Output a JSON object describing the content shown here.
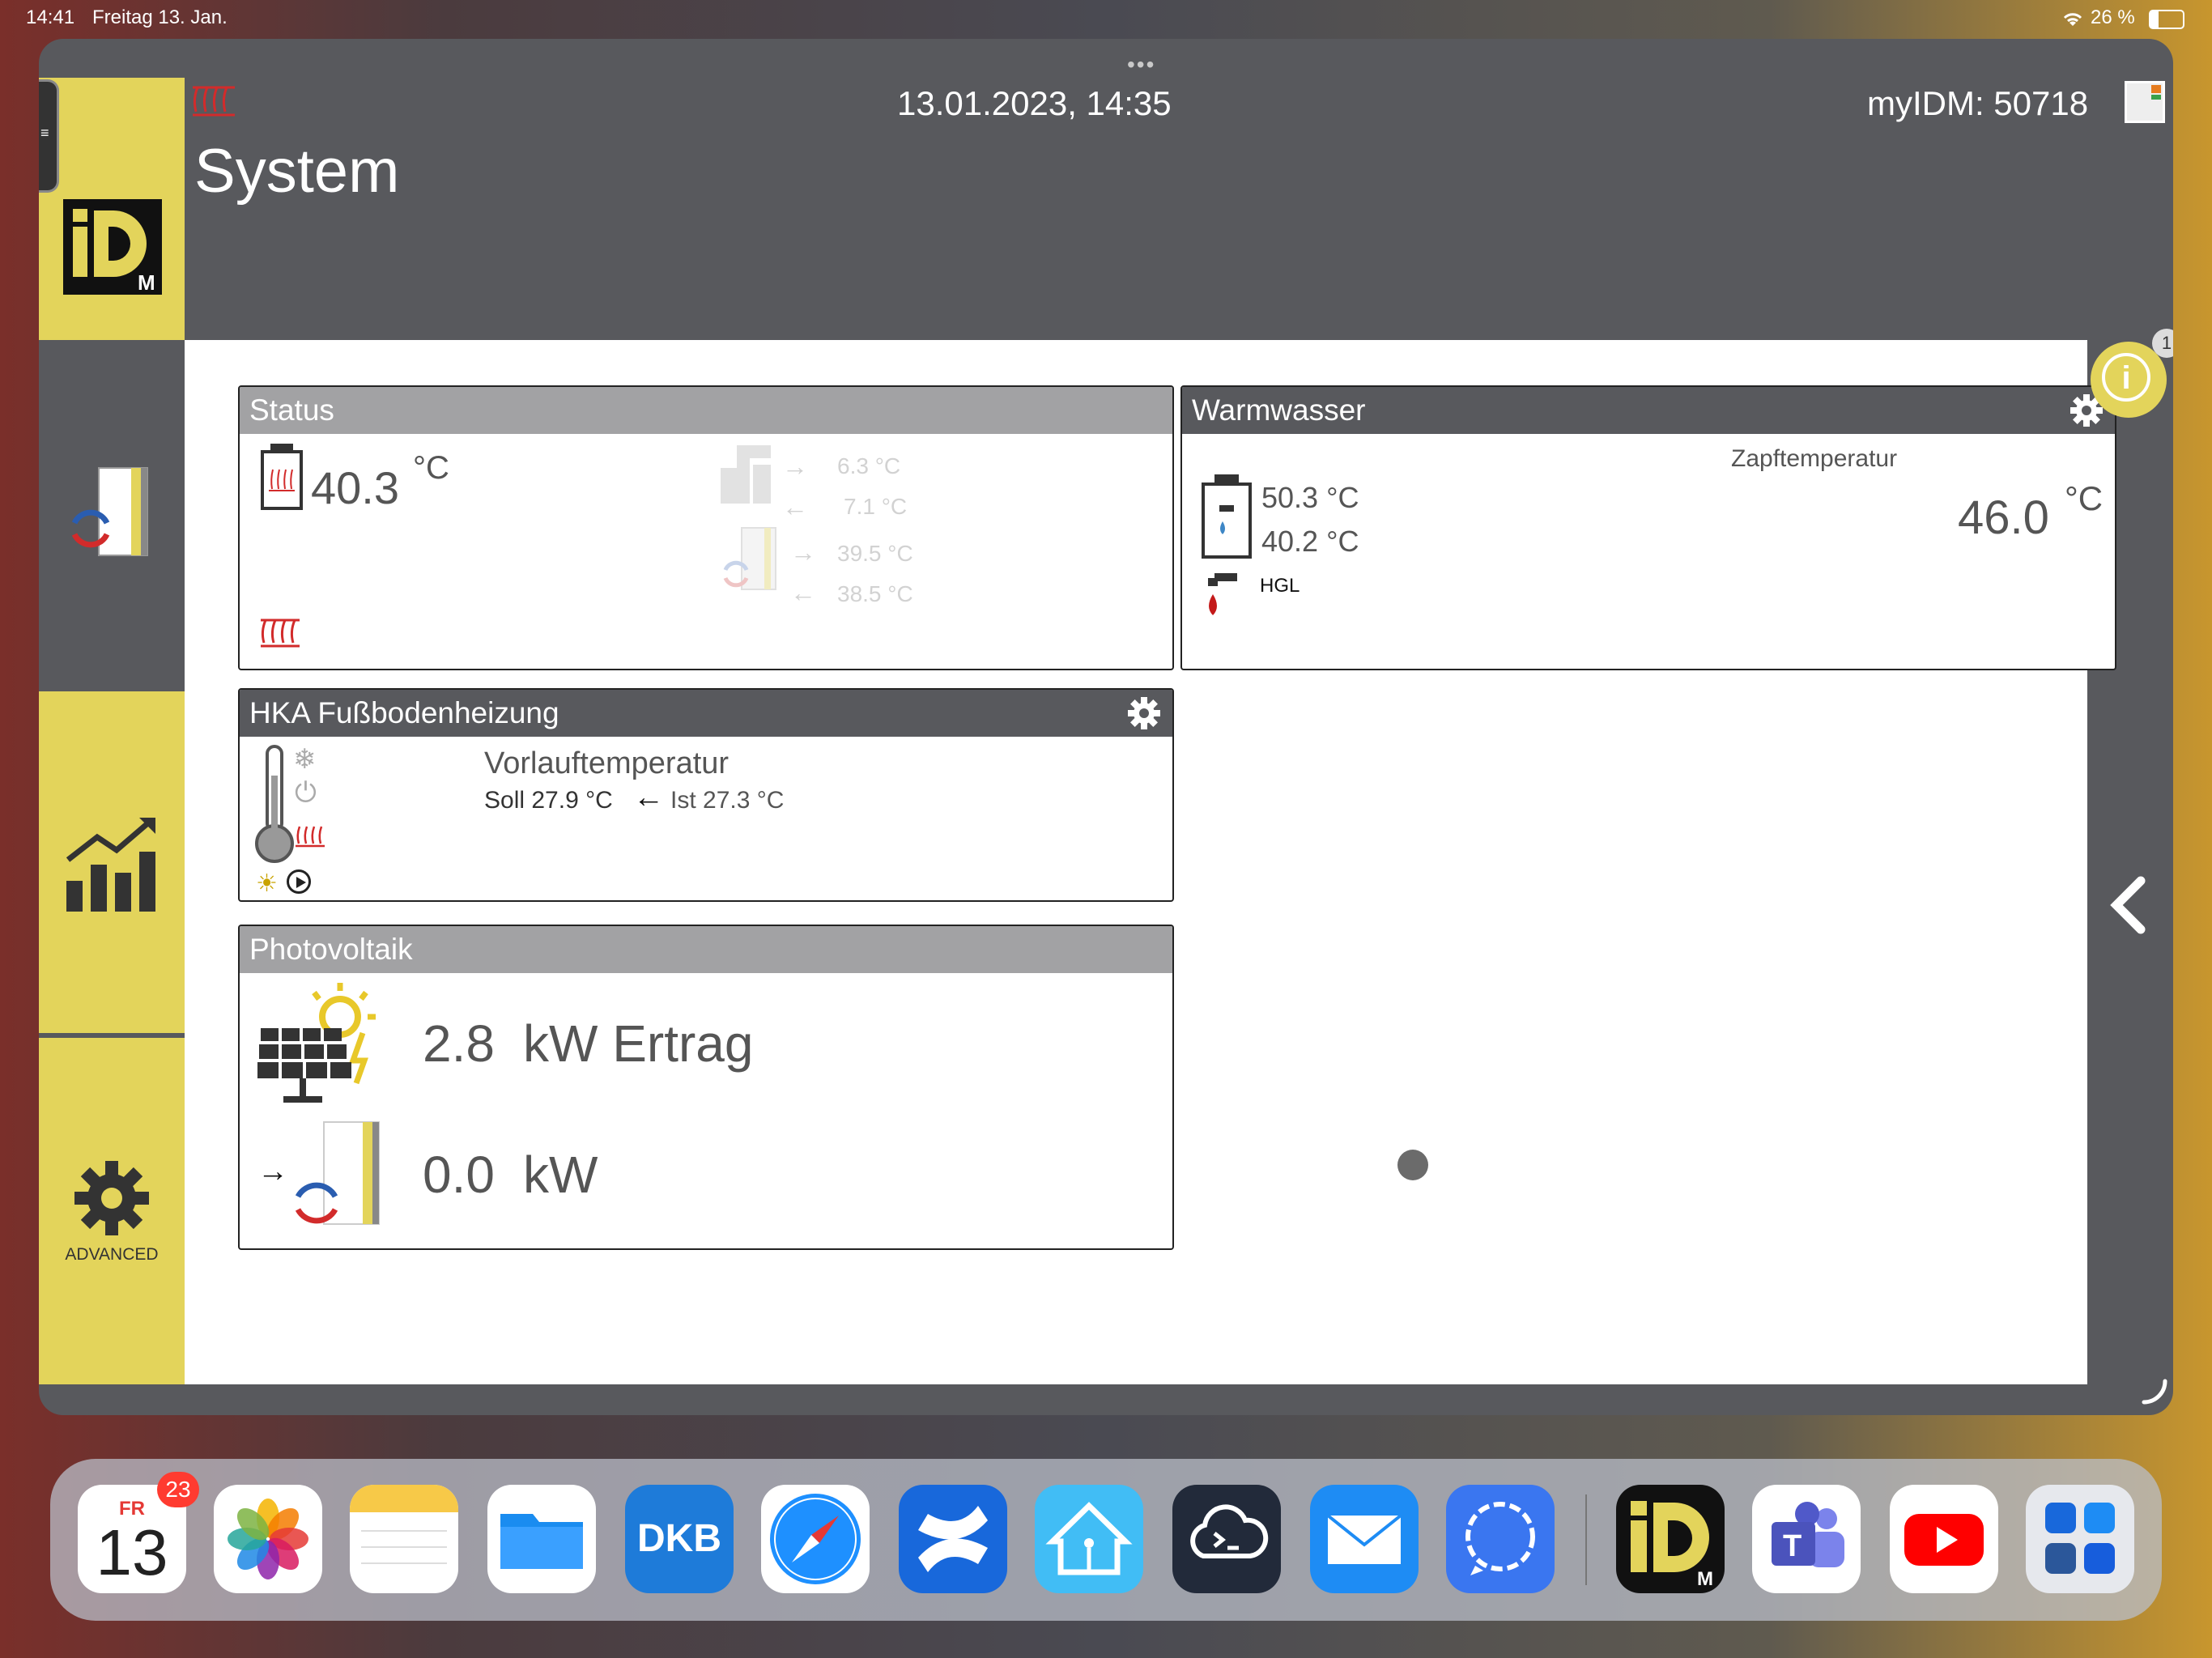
{
  "statusbar": {
    "time": "14:41",
    "date": "Freitag 13. Jan.",
    "battery": "26 %"
  },
  "header": {
    "datetime": "13.01.2023, 14:35",
    "myidm": "myIDM: 50718",
    "page_title": "System"
  },
  "sidebar": {
    "advanced_label": "ADVANCED"
  },
  "info_badge": "1",
  "status_panel": {
    "title": "Status",
    "storage_temp": "40.3",
    "unit": "°C",
    "source_in": "6.3 °C",
    "source_out": "7.1 °C",
    "hp_flow": "39.5 °C",
    "hp_return": "38.5 °C"
  },
  "warmwasser_panel": {
    "title": "Warmwasser",
    "top_temp": "50.3 °C",
    "bottom_temp": "40.2 °C",
    "hgl_label": "HGL",
    "zapf_label": "Zapftemperatur",
    "zapf_value": "46.0",
    "unit": "°C"
  },
  "hka_panel": {
    "title": "HKA Fußbodenheizung",
    "label": "Vorlauftemperatur",
    "soll": "Soll 27.9 °C",
    "ist": "Ist 27.3 °C"
  },
  "pv_panel": {
    "title": "Photovoltaik",
    "yield_value": "2.8",
    "yield_unit": "kW Ertrag",
    "hp_value": "0.0",
    "hp_unit": "kW"
  },
  "dock": {
    "calendar_day": "FR",
    "calendar_date": "13",
    "calendar_badge": "23",
    "apps": [
      "Calendar",
      "Photos",
      "Notes",
      "Files",
      "DKB",
      "Safari",
      "Confluence",
      "Home Assistant",
      "Prompt",
      "Mail",
      "Signal",
      "IDM",
      "Teams",
      "YouTube",
      "App Library"
    ],
    "dkb_label": "DKB"
  },
  "colors": {
    "brand_yellow": "#e3d45b",
    "window_dark": "#58595d",
    "heat_red": "#d22b2b",
    "panel_grey": "#a2a2a4"
  }
}
